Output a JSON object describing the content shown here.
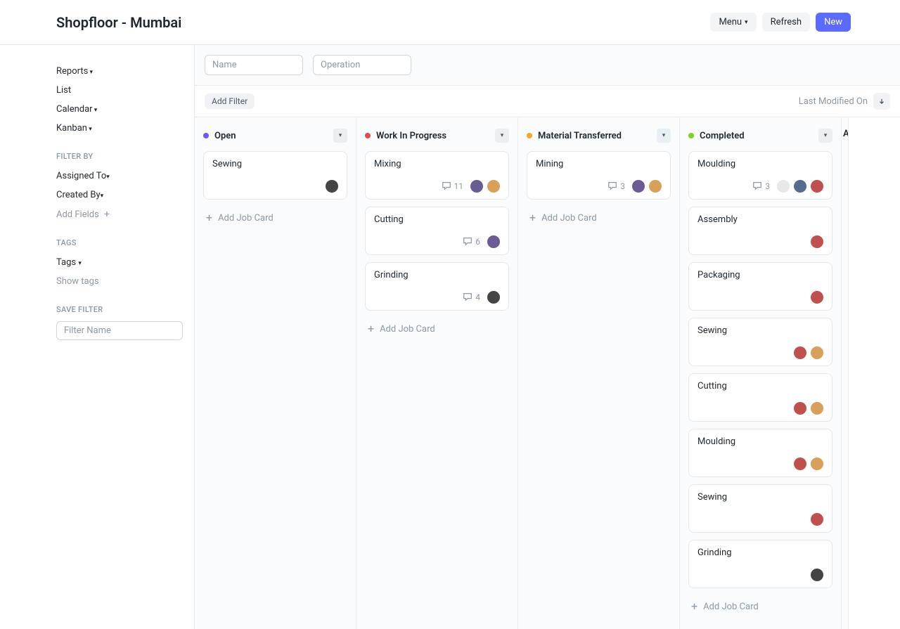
{
  "header": {
    "title": "Shopfloor - Mumbai",
    "menu_label": "Menu",
    "refresh_label": "Refresh",
    "new_label": "New"
  },
  "sidebar": {
    "views": [
      "Reports",
      "List",
      "Calendar",
      "Kanban"
    ],
    "view_has_caret": [
      true,
      false,
      true,
      true
    ],
    "filter_by_heading": "FILTER BY",
    "filter_items": [
      "Assigned To",
      "Created By"
    ],
    "add_fields_label": "Add Fields",
    "tags_heading": "TAGS",
    "tags_label": "Tags",
    "show_tags_label": "Show tags",
    "save_filter_heading": "SAVE FILTER",
    "filter_name_placeholder": "Filter Name"
  },
  "filters": {
    "name_placeholder": "Name",
    "operation_placeholder": "Operation",
    "add_filter_label": "Add Filter",
    "sort_label": "Last Modified On"
  },
  "columns": [
    {
      "title": "Open",
      "color": "#6b5bff",
      "cards": [
        {
          "title": "Sewing",
          "comments": null,
          "avatars": [
            "av6"
          ]
        }
      ],
      "add_label": "Add Job Card"
    },
    {
      "title": "Work In Progress",
      "color": "#e24c4c",
      "cards": [
        {
          "title": "Mixing",
          "comments": 11,
          "avatars": [
            "av1",
            "av2"
          ]
        },
        {
          "title": "Cutting",
          "comments": 6,
          "avatars": [
            "av1"
          ]
        },
        {
          "title": "Grinding",
          "comments": 4,
          "avatars": [
            "av6"
          ]
        }
      ],
      "add_label": "Add Job Card"
    },
    {
      "title": "Material Transferred",
      "color": "#f5a623",
      "cards": [
        {
          "title": "Mining",
          "comments": 3,
          "avatars": [
            "av1",
            "av2"
          ]
        }
      ],
      "add_label": "Add Job Card"
    },
    {
      "title": "Completed",
      "color": "#7ed321",
      "cards": [
        {
          "title": "Moulding",
          "comments": 3,
          "avatars": [
            "av4",
            "av5",
            "av3"
          ]
        },
        {
          "title": "Assembly",
          "comments": null,
          "avatars": [
            "av3"
          ]
        },
        {
          "title": "Packaging",
          "comments": null,
          "avatars": [
            "av3"
          ]
        },
        {
          "title": "Sewing",
          "comments": null,
          "avatars": [
            "av3",
            "av2"
          ]
        },
        {
          "title": "Cutting",
          "comments": null,
          "avatars": [
            "av3",
            "av2"
          ]
        },
        {
          "title": "Moulding",
          "comments": null,
          "avatars": [
            "av3",
            "av2"
          ]
        },
        {
          "title": "Sewing",
          "comments": null,
          "avatars": [
            "av3"
          ]
        },
        {
          "title": "Grinding",
          "comments": null,
          "avatars": [
            "av6"
          ]
        }
      ],
      "add_label": "Add Job Card"
    }
  ],
  "peek_letter": "A"
}
